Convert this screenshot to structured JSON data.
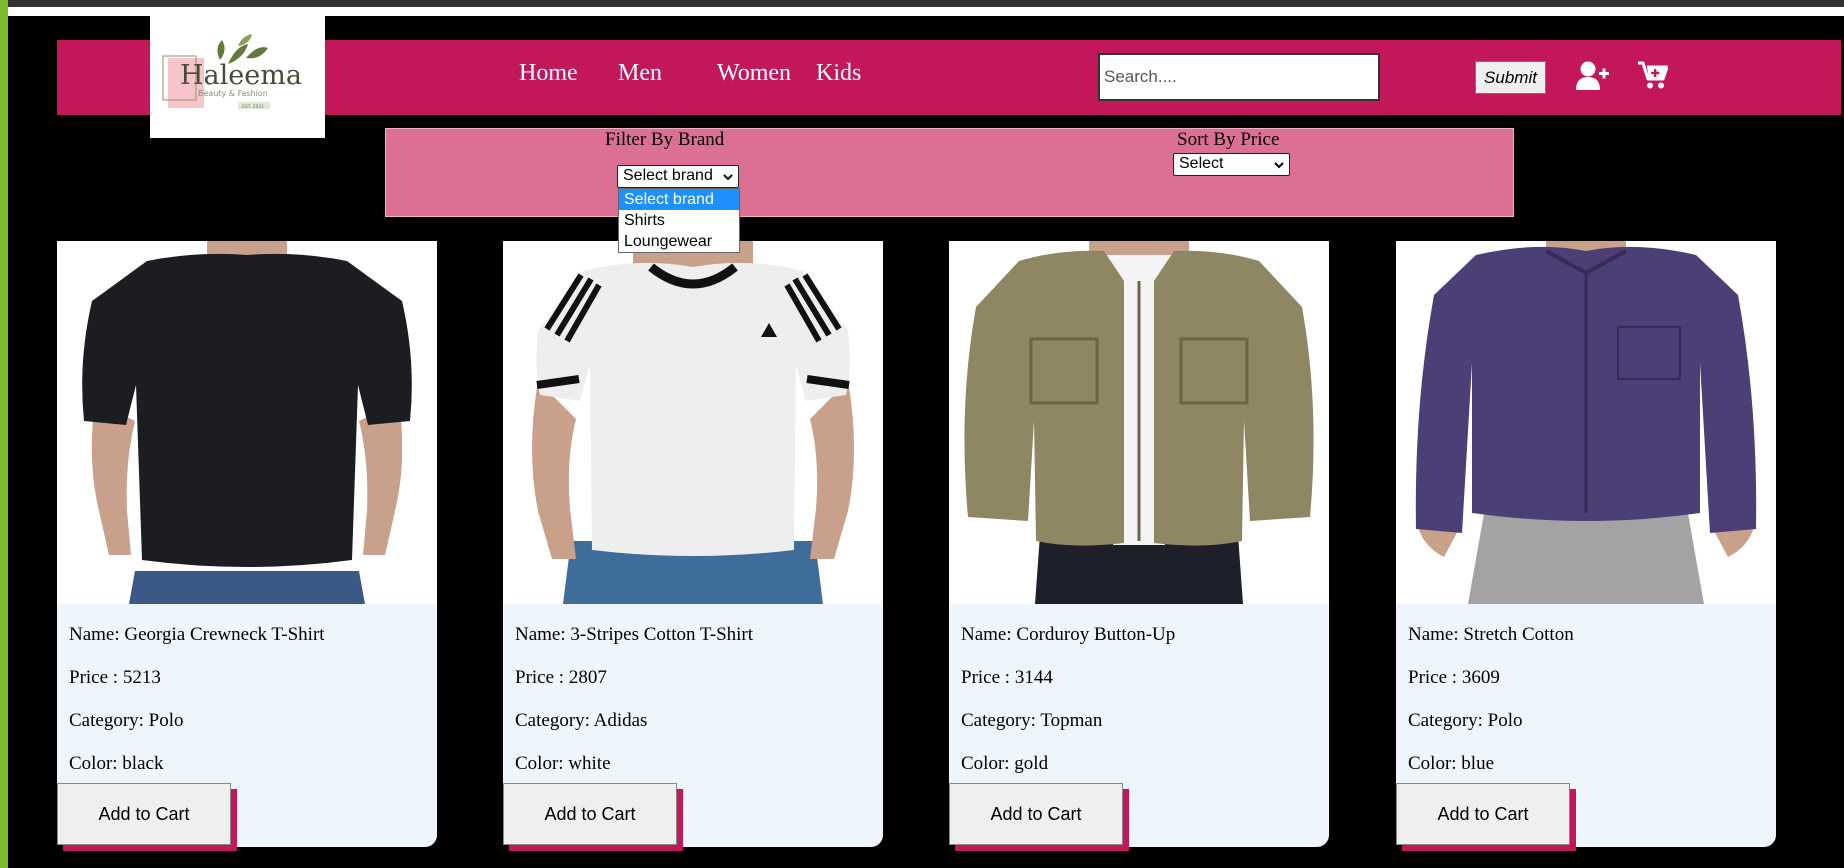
{
  "brand": {
    "logo_text": "Haleema",
    "logo_subtext": "Beauty & Fashion",
    "logo_badge": "EST. 2021"
  },
  "nav": {
    "links": [
      "Home",
      "Men",
      "Women",
      "Kids"
    ]
  },
  "search": {
    "placeholder": "Search....",
    "value": "",
    "submit_label": "Submit"
  },
  "icons": {
    "account": "user-plus-icon",
    "cart": "shopping-cart-icon"
  },
  "filters": {
    "brand_label": "Filter By Brand",
    "brand_selected": "Select brand",
    "brand_options": [
      "Select brand",
      "Shirts",
      "Loungewear"
    ],
    "brand_highlighted": 0,
    "sort_label": "Sort By Price",
    "sort_selected": "Select"
  },
  "products": [
    {
      "name": "Name: Georgia Crewneck T-Shirt",
      "price": "Price : 5213",
      "category": "Category: Polo",
      "color": "Color: black",
      "button": "Add to Cart",
      "shirt_color": "#1c1d20",
      "bottom_color": "#3a5a85"
    },
    {
      "name": "Name: 3-Stripes Cotton T-Shirt",
      "price": "Price : 2807",
      "category": "Category: Adidas",
      "color": "Color: white",
      "button": "Add to Cart",
      "shirt_color": "#eeeeee",
      "bottom_color": "#3f6d9a"
    },
    {
      "name": "Name: Corduroy Button-Up",
      "price": "Price : 3144",
      "category": "Category: Topman",
      "color": "Color: gold",
      "button": "Add to Cart",
      "shirt_color": "#8f8764",
      "bottom_color": "#1d1f2a"
    },
    {
      "name": "Name: Stretch Cotton",
      "price": "Price : 3609",
      "category": "Category: Polo",
      "color": "Color: blue",
      "button": "Add to Cart",
      "shirt_color": "#4b3f75",
      "bottom_color": "#a3a3a3"
    }
  ],
  "colors": {
    "navbar": "#c2185b",
    "filter_bar": "#db7093",
    "card_bg": "#eef5fd",
    "page_bg": "#000000"
  }
}
